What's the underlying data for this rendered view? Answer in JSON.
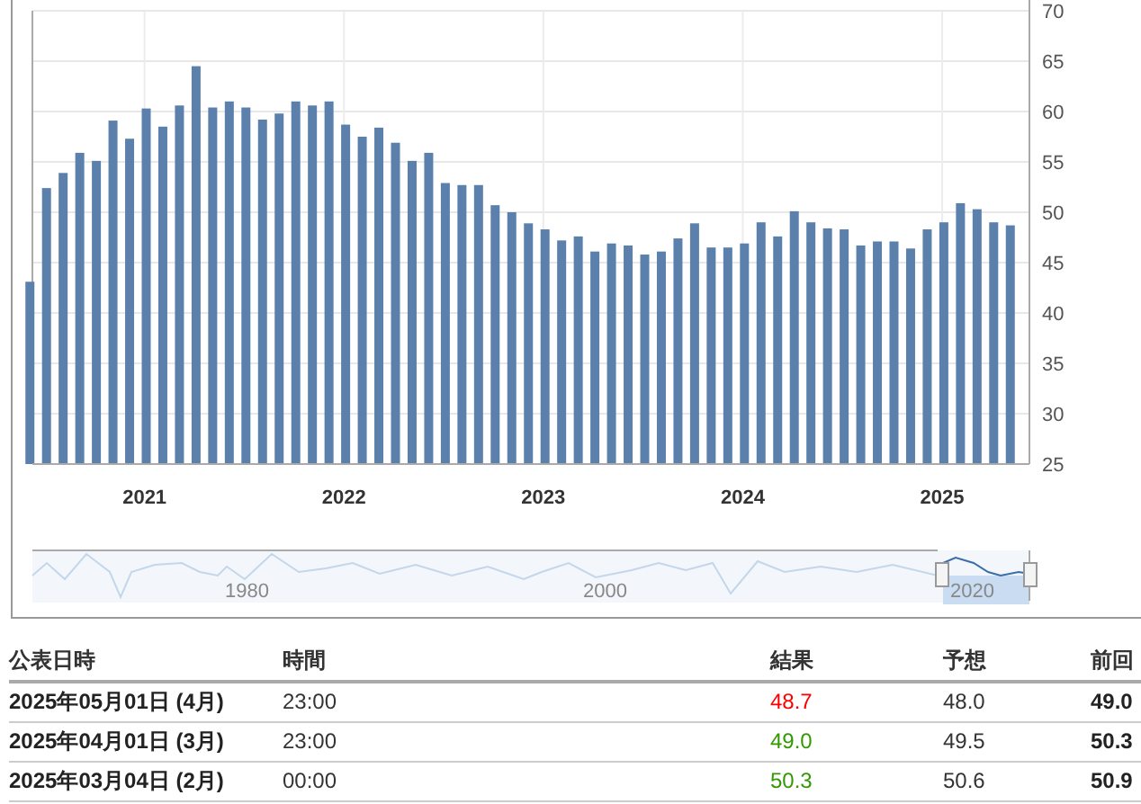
{
  "chart_data": {
    "type": "bar",
    "ylim": [
      25,
      70
    ],
    "yticks": [
      25,
      30,
      35,
      40,
      45,
      50,
      55,
      60,
      65,
      70
    ],
    "grid": true,
    "series": [
      {
        "color": "#5b80ac",
        "values": [
          43.1,
          52.4,
          53.9,
          55.9,
          55.1,
          59.1,
          57.3,
          60.3,
          58.5,
          60.6,
          64.5,
          60.4,
          61.0,
          60.4,
          59.2,
          59.8,
          61.0,
          60.6,
          61.0,
          58.7,
          57.5,
          58.4,
          56.9,
          55.1,
          55.9,
          52.9,
          52.7,
          52.7,
          50.7,
          50.0,
          48.9,
          48.3,
          47.2,
          47.6,
          46.1,
          46.9,
          46.7,
          45.8,
          46.1,
          47.4,
          48.9,
          46.5,
          46.5,
          46.9,
          49.0,
          47.6,
          50.1,
          49.0,
          48.4,
          48.3,
          46.7,
          47.1,
          47.1,
          46.4,
          48.3,
          49.0,
          50.9,
          50.3,
          49.0,
          48.7
        ]
      }
    ]
  },
  "x_axis": {
    "labels": [
      "2021",
      "2022",
      "2023",
      "2024",
      "2025"
    ]
  },
  "navigator": {
    "labels": [
      "1980",
      "2000",
      "2020"
    ]
  },
  "table": {
    "columns": [
      "公表日時",
      "時間",
      "結果",
      "予想",
      "前回"
    ],
    "rows": [
      {
        "date": "2025年05月01日 (4月)",
        "time": "23:00",
        "actual": "48.7",
        "color": "#ff0000",
        "forecast": "48.0",
        "previous": "49.0"
      },
      {
        "date": "2025年04月01日 (3月)",
        "time": "23:00",
        "actual": "49.0",
        "color": "#339900",
        "forecast": "49.5",
        "previous": "50.3"
      },
      {
        "date": "2025年03月04日 (2月)",
        "time": "00:00",
        "actual": "50.3",
        "color": "#339900",
        "forecast": "50.6",
        "previous": "50.9"
      }
    ]
  }
}
